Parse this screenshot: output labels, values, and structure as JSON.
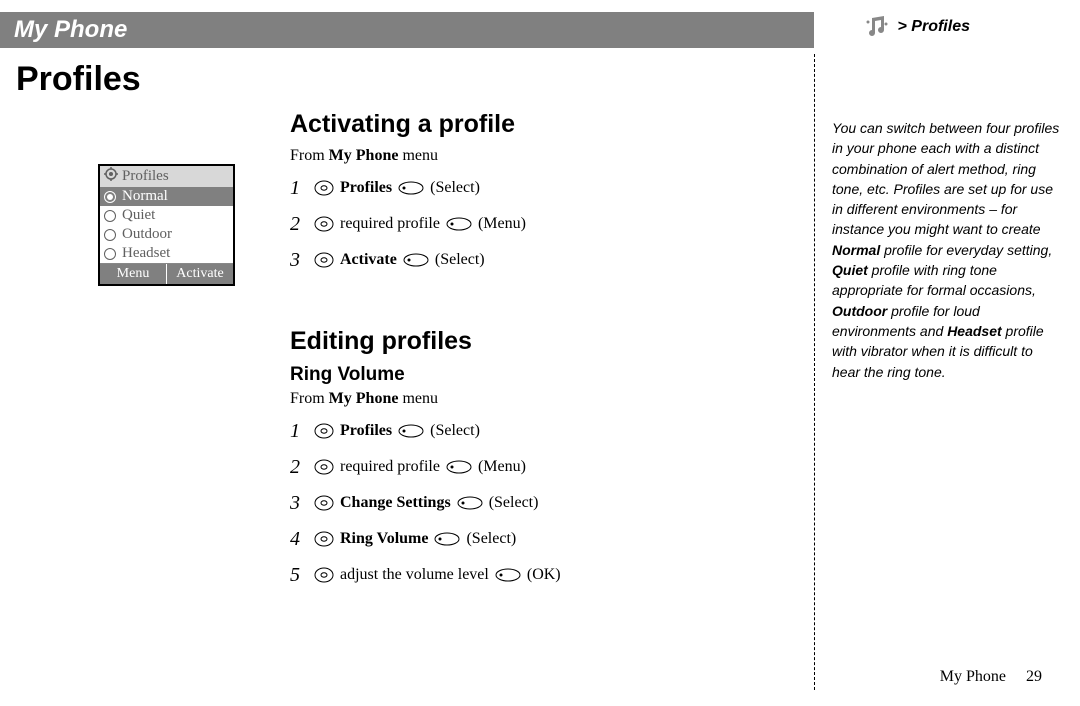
{
  "header": {
    "title": "My Phone"
  },
  "breadcrumb": {
    "path": "> Profiles"
  },
  "page_title": "Profiles",
  "sections": {
    "activating": {
      "heading": "Activating a profile",
      "from_prefix": "From ",
      "from_bold": "My Phone",
      "from_suffix": " menu",
      "steps": [
        {
          "n": "1",
          "bold": "Profiles",
          "text": "",
          "paren": "Select"
        },
        {
          "n": "2",
          "bold": "",
          "text": "required profile",
          "paren": "Menu"
        },
        {
          "n": "3",
          "bold": "Activate",
          "text": "",
          "paren": "Select"
        }
      ]
    },
    "editing": {
      "heading": "Editing profiles",
      "sub": "Ring Volume",
      "from_prefix": "From ",
      "from_bold": "My Phone",
      "from_suffix": " menu",
      "steps": [
        {
          "n": "1",
          "bold": "Profiles",
          "text": "",
          "paren": "Select"
        },
        {
          "n": "2",
          "bold": "",
          "text": "required profile",
          "paren": "Menu"
        },
        {
          "n": "3",
          "bold": "Change Settings",
          "text": "",
          "paren": "Select"
        },
        {
          "n": "4",
          "bold": "Ring Volume",
          "text": "",
          "paren": "Select"
        },
        {
          "n": "5",
          "bold": "",
          "text": "adjust the volume level",
          "paren": "OK"
        }
      ]
    }
  },
  "phone": {
    "title": "Profiles",
    "items": [
      {
        "label": "Normal",
        "selected": true
      },
      {
        "label": "Quiet",
        "selected": false
      },
      {
        "label": "Outdoor",
        "selected": false
      },
      {
        "label": "Headset",
        "selected": false
      }
    ],
    "soft_left": "Menu",
    "soft_right": "Activate"
  },
  "sidebar_segments": [
    {
      "t": "You can switch between four profiles in your phone each with a distinct combination of alert method, ring tone, etc. Profiles are set up for use in different environments – for instance you might want to create ",
      "b": false
    },
    {
      "t": "Normal",
      "b": true
    },
    {
      "t": " profile for everyday setting, ",
      "b": false
    },
    {
      "t": "Quiet",
      "b": true
    },
    {
      "t": " profile with ring tone appropriate for formal occasions, ",
      "b": false
    },
    {
      "t": "Outdoor",
      "b": true
    },
    {
      "t": " profile for loud environments and ",
      "b": false
    },
    {
      "t": "Headset",
      "b": true
    },
    {
      "t": " profile with vibrator when it is difficult to hear the ring tone.",
      "b": false
    }
  ],
  "footer": {
    "section": "My Phone",
    "page": "29"
  }
}
